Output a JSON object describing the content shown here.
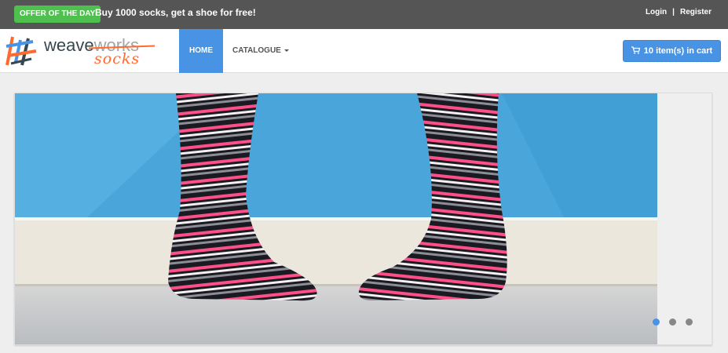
{
  "topbar": {
    "offer_badge": "OFFER OF THE DAY",
    "offer_text": "Buy 1000 socks, get a shoe for free!",
    "login": "Login",
    "separator": "|",
    "register": "Register"
  },
  "brand": {
    "name_part1": "weave",
    "name_part2": "works",
    "sub": "socks"
  },
  "nav": {
    "items": [
      {
        "label": "HOME",
        "active": true
      },
      {
        "label": "CATALOGUE",
        "has_dropdown": true
      }
    ]
  },
  "cart": {
    "label": "10 item(s) in cart",
    "icon": "shopping-cart-icon"
  },
  "carousel": {
    "slide_count": 3,
    "active_slide": 1
  },
  "colors": {
    "topbar_bg": "#555555",
    "offer_green": "#4fbf4f",
    "accent_blue": "#4993e4",
    "brand_orange": "#ff6a2e"
  }
}
